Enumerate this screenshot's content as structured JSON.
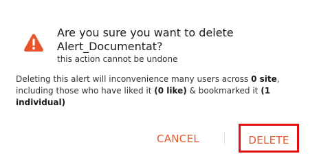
{
  "dialog": {
    "title_line1": "Are you sure you want to delete",
    "title_line2": "Alert_Documentat?",
    "subtitle": "this action cannot be undone",
    "message": {
      "part1": "Deleting this alert will inconvenience many users across ",
      "site_count": "0 site",
      "part2": ", including those who have liked it ",
      "like_count": "(0 like)",
      "part3": " & bookmarked it ",
      "bookmark_count": "(1 individual)"
    },
    "icon": "warning-icon",
    "icon_color": "#e8552a"
  },
  "actions": {
    "cancel_label": "CANCEL",
    "delete_label": "DELETE",
    "accent_color": "#e0592a",
    "highlight_color": "#e01010"
  }
}
